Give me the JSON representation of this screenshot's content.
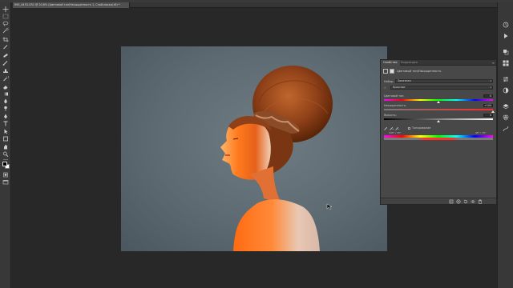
{
  "document": {
    "tab_title": "IMG_4453.CR2 @ 20,6% (Цветовой тон/Насыщенность 1, Слой-маска/16) *"
  },
  "toolbar": {
    "tools": [
      "move-icon",
      "marquee-icon",
      "lasso-icon",
      "quick-select-icon",
      "crop-icon",
      "eyedropper-icon",
      "healing-icon",
      "brush-icon",
      "stamp-icon",
      "history-brush-icon",
      "eraser-icon",
      "gradient-icon",
      "blur-icon",
      "dodge-icon",
      "pen-icon",
      "type-icon",
      "path-select-icon",
      "shape-icon",
      "hand-icon",
      "zoom-icon",
      "more-icon"
    ],
    "foreground_color": "#000000",
    "background_color": "#ffffff"
  },
  "rightbar": {
    "icons": [
      "history-icon",
      "actions-icon",
      "color-icon",
      "swatches-icon",
      "properties-icon",
      "adjustments-icon",
      "layers-icon",
      "channels-icon",
      "paths-icon"
    ]
  },
  "properties": {
    "tabs": [
      {
        "label": "Свойства",
        "active": true
      },
      {
        "label": "Коррекция",
        "active": false
      }
    ],
    "menu_icon": "panel-menu-icon",
    "title": "Цветовой тон/Насыщенность",
    "preset": {
      "label": "Набор:",
      "value": "Заказная"
    },
    "channel": {
      "value": "Красные"
    },
    "hue": {
      "label": "Цветовой тон:",
      "value": "0",
      "level": 0.5
    },
    "saturation": {
      "label": "Насыщенность:",
      "value": "+100",
      "level": 1.0
    },
    "lightness": {
      "label": "Яркость:",
      "value": "0",
      "level": 0.5
    },
    "colorize": {
      "label": "Тонирование",
      "checked": false
    },
    "range": {
      "left": "345° / 15°",
      "right": "45° \\ 75°"
    },
    "footer_icons": [
      "clip-to-layer-icon",
      "view-previous-icon",
      "reset-icon",
      "visibility-icon",
      "trash-icon"
    ]
  },
  "colors": {
    "app_bg": "#282828",
    "panel_bg": "#484848",
    "accent_skin": "#e8702a"
  }
}
